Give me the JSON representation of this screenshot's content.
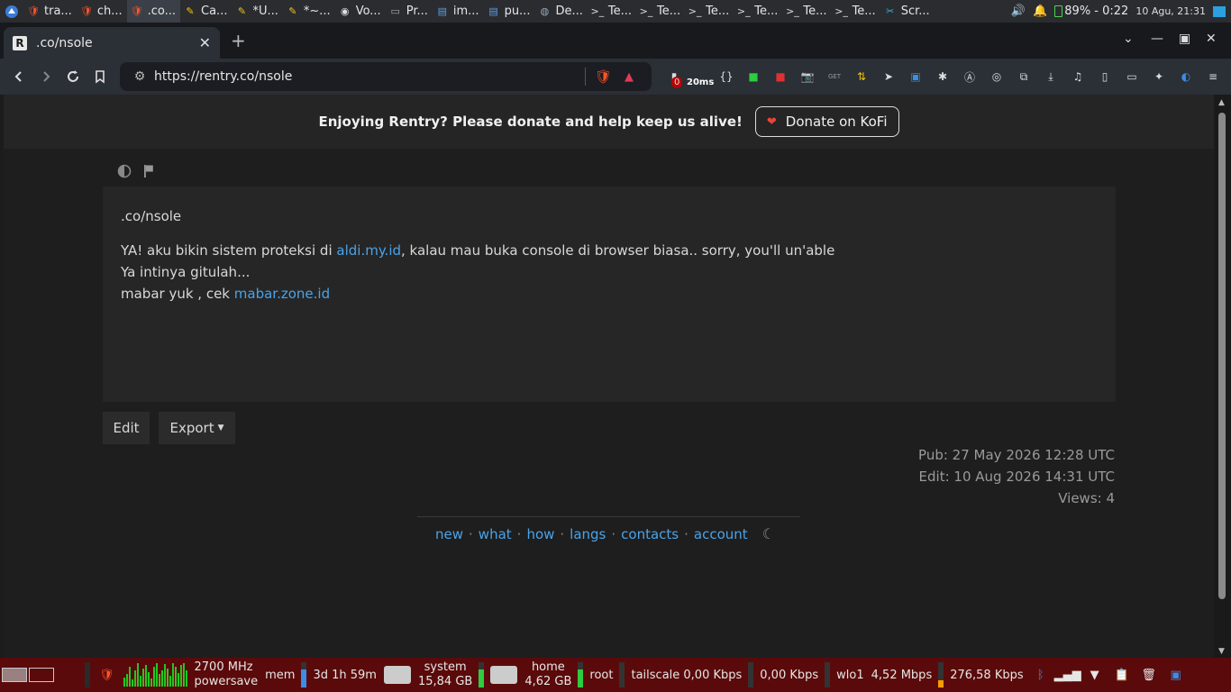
{
  "os_top": {
    "tasks": [
      {
        "icon": "brave-icon",
        "label": "tra..."
      },
      {
        "icon": "brave-icon",
        "label": "ch..."
      },
      {
        "icon": "brave-icon",
        "label": ".co..."
      },
      {
        "icon": "notes-icon",
        "label": "Ca..."
      },
      {
        "icon": "notes-icon",
        "label": "*U..."
      },
      {
        "icon": "notes-icon",
        "label": "*~..."
      },
      {
        "icon": "mouse-icon",
        "label": "Vo..."
      },
      {
        "icon": "window-icon",
        "label": "Pr..."
      },
      {
        "icon": "folder-icon",
        "label": "im..."
      },
      {
        "icon": "folder-icon",
        "label": "pu..."
      },
      {
        "icon": "app-icon",
        "label": "De..."
      },
      {
        "icon": "terminal-icon",
        "label": "Te..."
      },
      {
        "icon": "terminal-icon",
        "label": "Te..."
      },
      {
        "icon": "terminal-icon",
        "label": "Te..."
      },
      {
        "icon": "terminal-icon",
        "label": "Te..."
      },
      {
        "icon": "terminal-icon",
        "label": "Te..."
      },
      {
        "icon": "terminal-icon",
        "label": "Te..."
      },
      {
        "icon": "screenshot-icon",
        "label": "Scr..."
      }
    ],
    "battery": "89% - 0:22",
    "clock": "10 Agu, 21:31"
  },
  "browser": {
    "tab_title": ".co/nsole",
    "url": "https://rentry.co/nsole",
    "extension_badge_count": "0",
    "extension_badge_ping": "20ms"
  },
  "banner": {
    "message": "Enjoying Rentry? Please donate and help keep us alive!",
    "donate_label": "Donate on KoFi"
  },
  "content": {
    "title": ".co/nsole",
    "line1_prefix": "YA! aku bikin sistem proteksi di ",
    "line1_link": "aldi.my.id",
    "line1_suffix": ", kalau mau buka console di browser biasa.. sorry, you'll un'able",
    "line2": "Ya intinya gitulah...",
    "line3_prefix": "mabar yuk , cek ",
    "line3_link": "mabar.zone.id"
  },
  "actions": {
    "edit_label": "Edit",
    "export_label": "Export"
  },
  "meta": {
    "pub": "Pub: 27 May 2026 12:28 UTC",
    "edit": "Edit: 10 Aug 2026 14:31 UTC",
    "views": "Views: 4"
  },
  "footer": {
    "links": [
      "new",
      "what",
      "how",
      "langs",
      "contacts",
      "account"
    ]
  },
  "os_bottom": {
    "cpu_freq": "2700 MHz",
    "cpu_governor": "powersave",
    "mem_label": "mem",
    "uptime": "3d 1h 59m",
    "system_label": "system",
    "system_size": "15,84 GB",
    "home_label": "home",
    "home_size": "4,62 GB",
    "root_label": "root",
    "tailscale": "tailscale 0,00 Kbps",
    "tailscale2": "0,00 Kbps",
    "wlo1": "wlo1",
    "wlo1_down": "4,52 Mbps",
    "wlo1_up": "276,58 Kbps"
  }
}
